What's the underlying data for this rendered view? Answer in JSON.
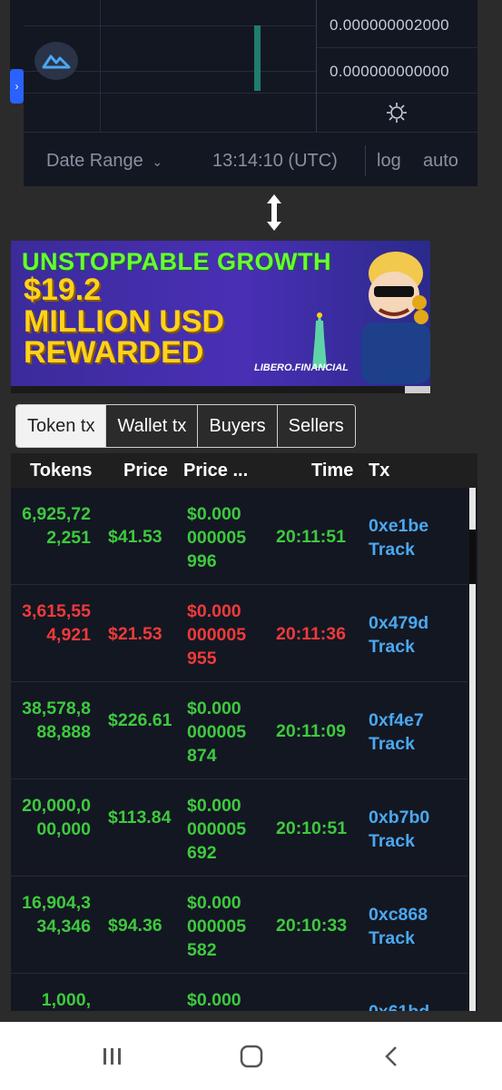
{
  "chart": {
    "price_labels": [
      "0.000000002000",
      "0.000000000000"
    ],
    "date_range_label": "Date Range",
    "time_label": "13:14:10 (UTC)",
    "log_label": "log",
    "auto_label": "auto"
  },
  "banner": {
    "line1": "UNSTOPPABLE GROWTH",
    "line2": "$19.2",
    "line3": "MILLION USD",
    "line4": "REWARDED",
    "brand": "LIBERO.FINANCIAL"
  },
  "tabs": [
    {
      "label": "Token tx",
      "active": true
    },
    {
      "label": "Wallet tx",
      "active": false
    },
    {
      "label": "Buyers",
      "active": false
    },
    {
      "label": "Sellers",
      "active": false
    }
  ],
  "table": {
    "headers": {
      "tokens": "Tokens",
      "price": "Price",
      "price_per_token": "Price ...",
      "time": "Time",
      "tx": "Tx"
    },
    "rows": [
      {
        "tokens": "6,925,722,251",
        "price": "$41.53",
        "price_per_token": "$0.000000005996",
        "time": "20:11:51",
        "tx": "0xe1be",
        "track": "Track",
        "side": "buy"
      },
      {
        "tokens": "3,615,554,921",
        "price": "$21.53",
        "price_per_token": "$0.000000005955",
        "time": "20:11:36",
        "tx": "0x479d",
        "track": "Track",
        "side": "sell"
      },
      {
        "tokens": "38,578,888,888",
        "price": "$226.61",
        "price_per_token": "$0.000000005874",
        "time": "20:11:09",
        "tx": "0xf4e7",
        "track": "Track",
        "side": "buy"
      },
      {
        "tokens": "20,000,000,000",
        "price": "$113.84",
        "price_per_token": "$0.000000005692",
        "time": "20:10:51",
        "tx": "0xb7b0",
        "track": "Track",
        "side": "buy"
      },
      {
        "tokens": "16,904,334,346",
        "price": "$94.36",
        "price_per_token": "$0.000000005582",
        "time": "20:10:33",
        "tx": "0xc868",
        "track": "Track",
        "side": "buy"
      },
      {
        "tokens": "1,000,",
        "price": "",
        "price_per_token": "$0.000",
        "time": "",
        "tx": "0x61bd",
        "track": "",
        "side": "buy"
      }
    ]
  },
  "colors": {
    "buy": "#3ec93e",
    "sell": "#ef3a3a",
    "link": "#4aa8f0",
    "panel": "#131722"
  }
}
